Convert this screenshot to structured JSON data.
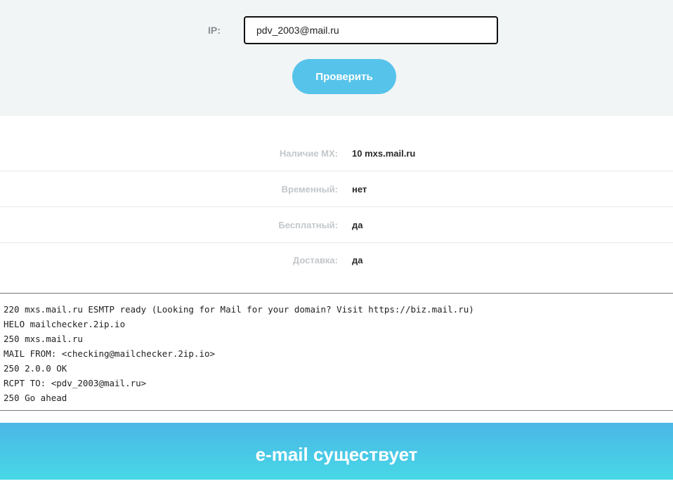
{
  "form": {
    "ip_label": "IP:",
    "ip_value": "pdv_2003@mail.ru",
    "check_button": "Проверить"
  },
  "info_rows": [
    {
      "label": "Наличие MX:",
      "value": "10 mxs.mail.ru"
    },
    {
      "label": "Временный:",
      "value": "нет"
    },
    {
      "label": "Бесплатный:",
      "value": "да"
    },
    {
      "label": "Доставка:",
      "value": "да"
    }
  ],
  "smtp_log": [
    "220 mxs.mail.ru ESMTP ready (Looking for Mail for your domain? Visit https://biz.mail.ru)",
    "HELO mailchecker.2ip.io",
    "250 mxs.mail.ru",
    "MAIL FROM: <checking@mailchecker.2ip.io>",
    "250 2.0.0 OK",
    "RCPT TO: <pdv_2003@mail.ru>",
    "250 Go ahead"
  ],
  "result": {
    "text": "e-mail существует"
  },
  "colors": {
    "accent": "#56c3ea",
    "banner_top": "#4bb6e6",
    "banner_bottom": "#47d8e6"
  }
}
